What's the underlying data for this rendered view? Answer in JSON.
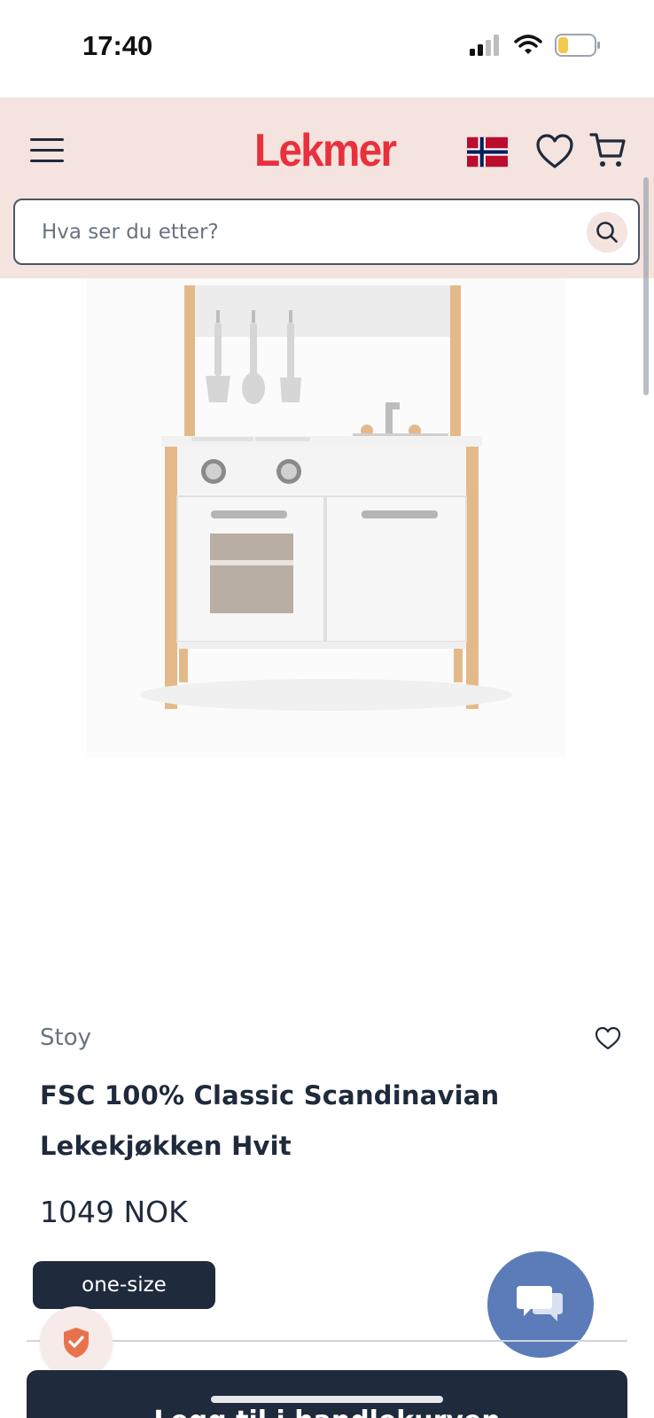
{
  "status_bar": {
    "time": "17:40"
  },
  "header": {
    "logo": "Lekmer",
    "search": {
      "placeholder": "Hva ser du etter?"
    }
  },
  "product": {
    "brand": "Stoy",
    "title": "FSC 100% Classic Scandinavian Lekekjøkken Hvit",
    "price": "1049 NOK",
    "size": "one-size",
    "image_alt": "white wooden play kitchen"
  },
  "cta": {
    "label": "Legg til i handlekurven"
  },
  "colors": {
    "header_bg": "#f4e3df",
    "brand_red": "#e8313c",
    "navy": "#1f2a3c",
    "chat_blue": "#5b7cb8"
  },
  "icons": [
    "menu-icon",
    "norway-flag-icon",
    "heart-icon",
    "cart-icon",
    "search-icon",
    "chat-icon",
    "shield-check-icon"
  ]
}
